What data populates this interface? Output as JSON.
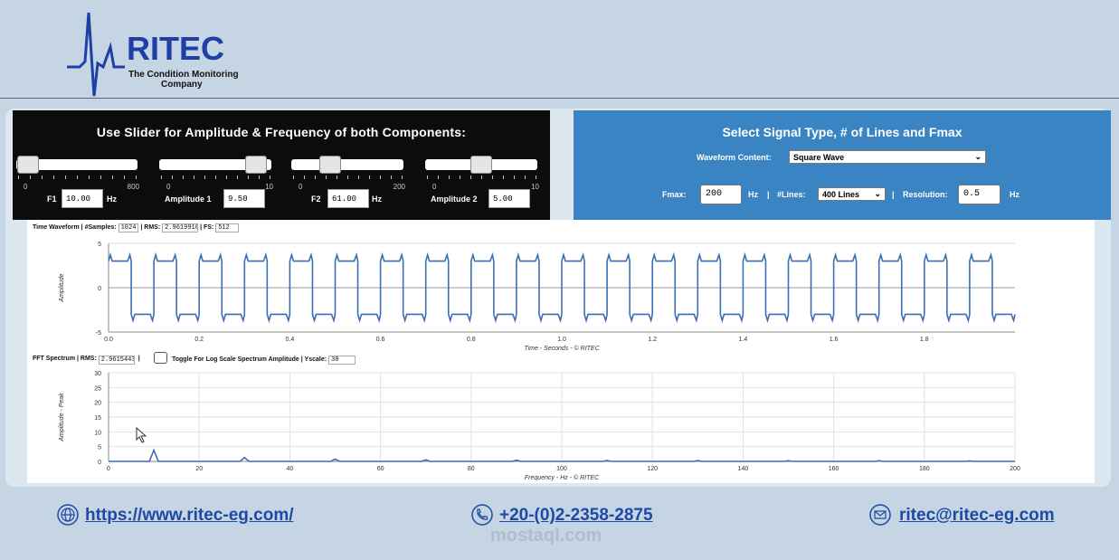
{
  "brand": {
    "name": "RITEC",
    "tagline_line1": "The Condition Monitoring",
    "tagline_line2": "Company",
    "color": "#1f3fa6"
  },
  "slider_panel": {
    "title": "Use Slider for Amplitude & Frequency of both Components:",
    "sliders": [
      {
        "label": "F1",
        "value": "10.00",
        "unit": "Hz",
        "min_label": "0",
        "max_label": "800",
        "level": 0.0125
      },
      {
        "label": "Amplitude 1",
        "value": "9.50",
        "unit": "",
        "min_label": "0",
        "max_label": "10",
        "level": 0.95
      },
      {
        "label": "F2",
        "value": "61.00",
        "unit": "Hz",
        "min_label": "0",
        "max_label": "200",
        "level": 0.305
      },
      {
        "label": "Amplitude 2",
        "value": "5.00",
        "unit": "",
        "min_label": "0",
        "max_label": "10",
        "level": 0.5
      }
    ]
  },
  "signal_panel": {
    "title": "Select Signal Type, # of Lines and Fmax",
    "waveform_label": "Waveform Content:",
    "waveform_value": "Square Wave",
    "fmax_label": "Fmax:",
    "fmax_value": "200",
    "fmax_unit": "Hz",
    "separator": "|",
    "lines_label": "#Lines:",
    "lines_value": "400 Lines",
    "resolution_label": "Resolution:",
    "resolution_value": "0.5",
    "resolution_unit": "Hz",
    "color": "#3a84c3"
  },
  "time_plot": {
    "info_title": "Time Waveform |",
    "samples_label": "#Samples:",
    "samples_value": "1024",
    "rms_label": "| RMS:",
    "rms_value": "2.9619910",
    "fs_label": "| FS:",
    "fs_value": "512"
  },
  "fft_plot": {
    "info_title": "FFT Spectrum |",
    "rms_label": "RMS:",
    "rms_value": "2.9615443",
    "toggle_label": "Toggle For Log Scale Spectrum Amplitude |",
    "yscale_label": "Yscale:",
    "yscale_value": "30"
  },
  "chart_data": [
    {
      "type": "line",
      "name": "time-waveform",
      "xlabel": "Time - Seconds - © RITEC",
      "ylabel": "Amplitude",
      "xlim": [
        0,
        2
      ],
      "ylim": [
        -5,
        5
      ],
      "x_ticks": [
        "0.0",
        "0.2",
        "0.4",
        "0.6",
        "0.8",
        "1.0",
        "1.2",
        "1.4",
        "1.6",
        "1.8"
      ],
      "y_ticks": [
        "5",
        "0",
        "-5"
      ],
      "waveform": "square",
      "frequency_hz": 10,
      "amplitude": 3,
      "overshoot_peak": 3.7,
      "color": "#3a6fb5"
    },
    {
      "type": "line",
      "name": "fft-spectrum",
      "xlabel": "Frequency - Hz - © RITEC",
      "ylabel": "Amplitude - Peak",
      "xlim": [
        0,
        200
      ],
      "ylim": [
        0,
        30
      ],
      "x_ticks": [
        "0",
        "20",
        "40",
        "60",
        "80",
        "100",
        "120",
        "140",
        "160",
        "180",
        "200"
      ],
      "y_ticks": [
        "30",
        "25",
        "20",
        "15",
        "10",
        "5",
        "0"
      ],
      "peaks": [
        {
          "x": 10,
          "y": 3.8
        },
        {
          "x": 30,
          "y": 1.3
        },
        {
          "x": 50,
          "y": 0.8
        },
        {
          "x": 70,
          "y": 0.5
        },
        {
          "x": 90,
          "y": 0.4
        },
        {
          "x": 110,
          "y": 0.3
        },
        {
          "x": 130,
          "y": 0.25
        },
        {
          "x": 150,
          "y": 0.2
        },
        {
          "x": 170,
          "y": 0.2
        },
        {
          "x": 190,
          "y": 0.15
        }
      ],
      "color": "#3a6fb5"
    }
  ],
  "footer": {
    "website": "https://www.ritec-eg.com/",
    "phone": "+20-(0)2-2358-2875",
    "email": "ritec@ritec-eg.com",
    "watermark": "mostaql.com",
    "link_color": "#1f49a6"
  }
}
